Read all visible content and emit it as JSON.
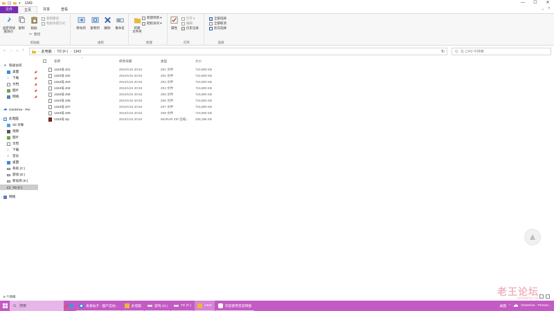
{
  "window": {
    "title": "1343",
    "controls": {
      "minimize": "—",
      "maximize": "☐",
      "close": "✕"
    }
  },
  "ribbon": {
    "tabs": [
      {
        "label": "文件"
      },
      {
        "label": "主页"
      },
      {
        "label": "共享"
      },
      {
        "label": "查看"
      }
    ],
    "expand_hint": "⌄",
    "help": "?",
    "groups": {
      "clipboard": {
        "label": "剪贴板",
        "pin": "固定到快\n速访问",
        "copy": "复制",
        "paste": "粘贴",
        "cut": "剪切",
        "copy_path": "复制路径",
        "paste_shortcut": "粘贴快捷方式"
      },
      "organize": {
        "label": "组织",
        "move_to": "移动到",
        "copy_to": "复制到",
        "delete": "删除",
        "rename": "重命名"
      },
      "new": {
        "label": "新建",
        "new_folder": "新建\n文件夹",
        "new_item": "新建项目 ▾",
        "easy_access": "轻松访问 ▾"
      },
      "open": {
        "label": "打开",
        "properties": "属性",
        "open": "打开 ▾",
        "edit": "编辑",
        "history": "历史记录"
      },
      "select": {
        "label": "选择",
        "select_all": "全部选择",
        "select_none": "全部取消",
        "invert": "反向选择"
      }
    }
  },
  "address": {
    "back": "←",
    "forward": "→",
    "recent": "⌄",
    "up": "↑",
    "segments": [
      "此电脑",
      "TD (F:)",
      "1343"
    ],
    "separator": "›",
    "dropdown": "⌄",
    "refresh": "↻",
    "search_placeholder": "在 1343 中搜索"
  },
  "navpane": {
    "items": [
      {
        "label": "快速访问",
        "icon": "star-icon",
        "pinned": false,
        "selected": false
      },
      {
        "label": "桌面",
        "icon": "desktop-icon",
        "pinned": true,
        "selected": false
      },
      {
        "label": "下载",
        "icon": "download-icon",
        "pinned": true,
        "selected": false
      },
      {
        "label": "文档",
        "icon": "document-icon",
        "pinned": true,
        "selected": false
      },
      {
        "label": "图片",
        "icon": "picture-icon",
        "pinned": true,
        "selected": false
      },
      {
        "label": "网络",
        "icon": "network-icon",
        "pinned": true,
        "selected": false
      },
      {
        "label": "OneDrive - Per",
        "icon": "cloud-icon",
        "pinned": false,
        "selected": false
      },
      {
        "label": "此电脑",
        "icon": "computer-icon",
        "pinned": false,
        "selected": false
      },
      {
        "label": "3D 对象",
        "icon": "cube-icon",
        "pinned": false,
        "selected": false
      },
      {
        "label": "视频",
        "icon": "video-icon",
        "pinned": false,
        "selected": false
      },
      {
        "label": "图片",
        "icon": "picture-icon",
        "pinned": false,
        "selected": false
      },
      {
        "label": "文档",
        "icon": "document-icon",
        "pinned": false,
        "selected": false
      },
      {
        "label": "下载",
        "icon": "download-icon",
        "pinned": false,
        "selected": false
      },
      {
        "label": "音乐",
        "icon": "music-icon",
        "pinned": false,
        "selected": false
      },
      {
        "label": "桌面",
        "icon": "desktop-icon",
        "pinned": false,
        "selected": false
      },
      {
        "label": "系统 (C:)",
        "icon": "drive-icon",
        "pinned": false,
        "selected": false
      },
      {
        "label": "游戏 (D:)",
        "icon": "drive-icon",
        "pinned": false,
        "selected": false
      },
      {
        "label": "新加卷 (E:)",
        "icon": "drive-icon",
        "pinned": false,
        "selected": false
      },
      {
        "label": "TD (F:)",
        "icon": "drive-icon",
        "pinned": false,
        "selected": true
      },
      {
        "label": "网络",
        "icon": "network-icon",
        "pinned": false,
        "selected": false
      }
    ],
    "pin_glyph": "📌",
    "caret": "›"
  },
  "files": {
    "columns": {
      "name": "名称",
      "date": "修改日期",
      "type": "类型",
      "size": "大小"
    },
    "sort_indicator": "^",
    "rows": [
      {
        "name": "1343号.z01",
        "date": "2024/1/24 20:54",
        "type": "Z01 文件",
        "size": "716,800 KB",
        "icon": "file-icon"
      },
      {
        "name": "1343号.z02",
        "date": "2024/1/24 20:53",
        "type": "Z02 文件",
        "size": "716,800 KB",
        "icon": "file-icon"
      },
      {
        "name": "1343号.z03",
        "date": "2024/1/24 20:53",
        "type": "Z03 文件",
        "size": "716,800 KB",
        "icon": "file-icon"
      },
      {
        "name": "1343号.z04",
        "date": "2024/1/24 20:53",
        "type": "Z04 文件",
        "size": "716,800 KB",
        "icon": "file-icon"
      },
      {
        "name": "1343号.z05",
        "date": "2024/1/24 20:53",
        "type": "Z05 文件",
        "size": "716,800 KB",
        "icon": "file-icon"
      },
      {
        "name": "1343号.z06",
        "date": "2024/1/24 20:53",
        "type": "Z06 文件",
        "size": "716,800 KB",
        "icon": "file-icon"
      },
      {
        "name": "1343号.z07",
        "date": "2024/1/24 20:53",
        "type": "Z07 文件",
        "size": "716,800 KB",
        "icon": "file-icon"
      },
      {
        "name": "1343号.z08",
        "date": "2024/1/24 20:54",
        "type": "Z08 文件",
        "size": "716,800 KB",
        "icon": "file-icon"
      },
      {
        "name": "1343号.zip",
        "date": "2024/1/24 20:54",
        "type": "WinRAR ZIP 压缩...",
        "size": "338,285 KB",
        "icon": "winrar-icon"
      }
    ]
  },
  "status": {
    "count": "9 个项目"
  },
  "watermark": {
    "line1": "老王论坛",
    "line2": "laowang.vip"
  },
  "taskbar": {
    "search_placeholder": "搜索",
    "apps": [
      {
        "label": "发表帖子 - 国产自拍...",
        "icon": "browser-icon",
        "active": false
      },
      {
        "label": "此电脑",
        "icon": "folder-icon",
        "active": false
      },
      {
        "label": "游戏 (D:)",
        "icon": "drive-icon",
        "active": false
      },
      {
        "label": "TD (F:)",
        "icon": "drive-icon",
        "active": false
      },
      {
        "label": "1343",
        "icon": "folder-icon",
        "active": true
      },
      {
        "label": "欢迎使用百度网盘",
        "icon": "cloud-app-icon",
        "active": false
      }
    ],
    "tray": {
      "zone": "桌面",
      "onedrive": "OneDrive - Person..."
    }
  },
  "colors": {
    "accent": "#7a2bb5",
    "taskbar": "#c45ac4",
    "folder": "#e8b93a",
    "zip_icon": "#8b2a1a"
  }
}
